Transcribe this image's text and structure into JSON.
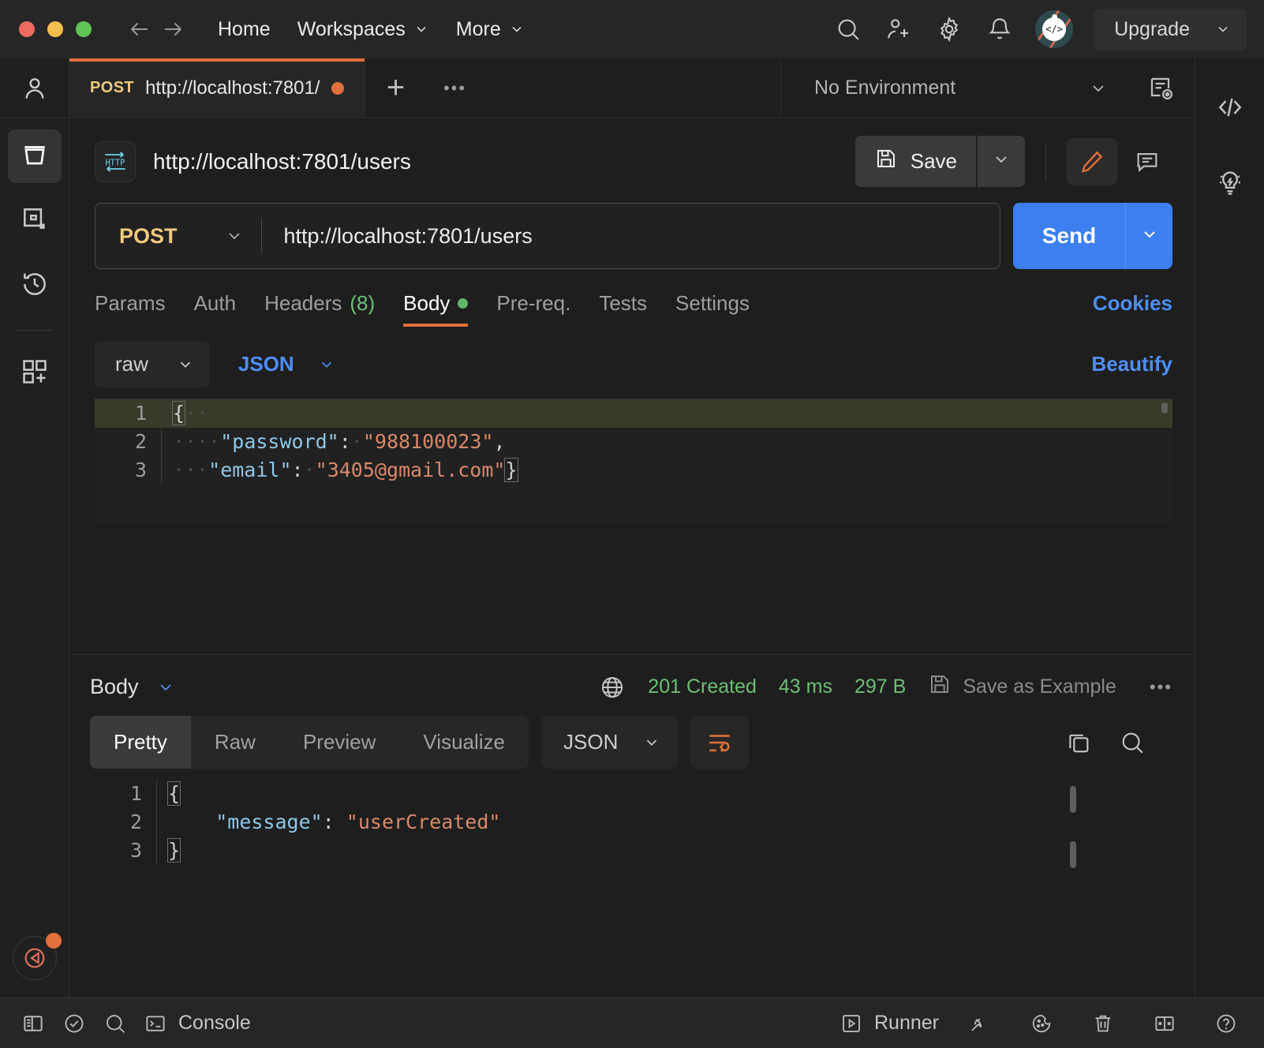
{
  "window": {
    "traffic_lights": [
      "close",
      "minimize",
      "maximize"
    ]
  },
  "header": {
    "back_icon": "arrow-left-icon",
    "forward_icon": "arrow-right-icon",
    "nav": [
      {
        "label": "Home",
        "has_caret": false
      },
      {
        "label": "Workspaces",
        "has_caret": true
      },
      {
        "label": "More",
        "has_caret": true
      }
    ],
    "icons": [
      "search-icon",
      "invite-user-icon",
      "settings-gear-icon",
      "notifications-bell-icon"
    ],
    "avatar": "user-avatar",
    "avatar_glyph": "</>",
    "upgrade_label": "Upgrade"
  },
  "left_rail": {
    "items": [
      {
        "name": "profile",
        "icon": "user-icon",
        "active": false
      },
      {
        "name": "collections",
        "icon": "collections-bucket-icon",
        "active": true
      },
      {
        "name": "environments",
        "icon": "environments-icon",
        "active": false
      },
      {
        "name": "history",
        "icon": "history-clock-icon",
        "active": false
      },
      {
        "name": "new-apps",
        "icon": "apps-add-icon",
        "active": false
      }
    ],
    "bottom_icon": "postman-status-icon"
  },
  "tab_strip": {
    "tabs": [
      {
        "method": "POST",
        "name": "http://localhost:7801/",
        "unsaved": true,
        "active": true
      }
    ],
    "new_tab_icon": "plus-icon",
    "more_icon": "ellipsis-icon",
    "environment_value": "No Environment",
    "environment_quick_look_icon": "environment-quick-look-icon"
  },
  "request": {
    "protocol_icon": "http-icon",
    "title": "http://localhost:7801/users",
    "save_label": "Save",
    "save_icon": "floppy-disk-icon",
    "save_caret_icon": "chevron-down-icon",
    "edit_icon": "pencil-edit-icon",
    "comment_icon": "comment-icon",
    "method": "POST",
    "method_caret_icon": "chevron-down-icon",
    "url": "http://localhost:7801/users",
    "send_label": "Send",
    "send_caret_icon": "chevron-down-icon",
    "tabs": [
      {
        "label": "Params",
        "active": false,
        "count": null,
        "dot": false
      },
      {
        "label": "Auth",
        "active": false,
        "count": null,
        "dot": false
      },
      {
        "label": "Headers",
        "active": false,
        "count": "(8)",
        "dot": false
      },
      {
        "label": "Body",
        "active": true,
        "count": null,
        "dot": true
      },
      {
        "label": "Pre-req.",
        "active": false,
        "count": null,
        "dot": false
      },
      {
        "label": "Tests",
        "active": false,
        "count": null,
        "dot": false
      },
      {
        "label": "Settings",
        "active": false,
        "count": null,
        "dot": false
      }
    ],
    "cookies_label": "Cookies",
    "body_mode": "raw",
    "body_format": "JSON",
    "beautify_label": "Beautify",
    "body_lines": [
      {
        "num": "1",
        "highlighted": true,
        "tokens": [
          {
            "t": "{",
            "c": "brace"
          },
          {
            "t": "··",
            "c": "ws"
          }
        ]
      },
      {
        "num": "2",
        "highlighted": false,
        "tokens": [
          {
            "t": "····",
            "c": "ws"
          },
          {
            "t": "\"password\"",
            "c": "k"
          },
          {
            "t": ":",
            "c": "p"
          },
          {
            "t": "·",
            "c": "ws"
          },
          {
            "t": "\"988100023\"",
            "c": "s"
          },
          {
            "t": ",",
            "c": "p"
          }
        ]
      },
      {
        "num": "3",
        "highlighted": false,
        "tokens": [
          {
            "t": "···",
            "c": "ws"
          },
          {
            "t": "\"email\"",
            "c": "k"
          },
          {
            "t": ":",
            "c": "p"
          },
          {
            "t": "·",
            "c": "ws"
          },
          {
            "t": "\"3405@gmail.com\"",
            "c": "s"
          },
          {
            "t": "}",
            "c": "brace"
          }
        ]
      }
    ]
  },
  "response": {
    "body_label": "Body",
    "body_caret_icon": "chevron-down-icon",
    "globe_icon": "globe-icon",
    "status": "201 Created",
    "time": "43 ms",
    "size": "297 B",
    "save_example_label": "Save as Example",
    "save_example_icon": "floppy-disk-icon",
    "more_icon": "ellipsis-icon",
    "view_tabs": [
      {
        "label": "Pretty",
        "active": true
      },
      {
        "label": "Raw",
        "active": false
      },
      {
        "label": "Preview",
        "active": false
      },
      {
        "label": "Visualize",
        "active": false
      }
    ],
    "format": "JSON",
    "format_caret_icon": "chevron-down-icon",
    "wrap_icon": "word-wrap-icon",
    "copy_icon": "copy-icon",
    "search_icon": "search-icon",
    "body_lines": [
      {
        "num": "1",
        "highlighted": false,
        "tokens": [
          {
            "t": "{",
            "c": "brace"
          }
        ]
      },
      {
        "num": "2",
        "highlighted": false,
        "tokens": [
          {
            "t": "    ",
            "c": "ws"
          },
          {
            "t": "\"message\"",
            "c": "k"
          },
          {
            "t": ": ",
            "c": "p"
          },
          {
            "t": "\"userCreated\"",
            "c": "s"
          }
        ]
      },
      {
        "num": "3",
        "highlighted": false,
        "tokens": [
          {
            "t": "}",
            "c": "brace"
          }
        ]
      }
    ]
  },
  "right_rail": {
    "items": [
      {
        "name": "code-snippet",
        "icon": "code-brackets-icon"
      },
      {
        "name": "postbot",
        "icon": "lightbulb-icon"
      }
    ]
  },
  "bottom_bar": {
    "left_icons": [
      "sidebar-toggle-icon",
      "check-circle-icon",
      "search-icon"
    ],
    "console_label": "Console",
    "console_icon": "terminal-icon",
    "runner_label": "Runner",
    "runner_icon": "play-box-icon",
    "right_icons": [
      "capture-requests-icon",
      "cookies-icon",
      "trash-icon",
      "two-pane-layout-icon",
      "help-circle-icon"
    ]
  },
  "colors": {
    "accent_orange": "#e2703a",
    "send_blue": "#3b7ff0",
    "link_blue": "#4e8ef5",
    "status_green": "#6bbf73",
    "method_yellow": "#f2c97d"
  }
}
